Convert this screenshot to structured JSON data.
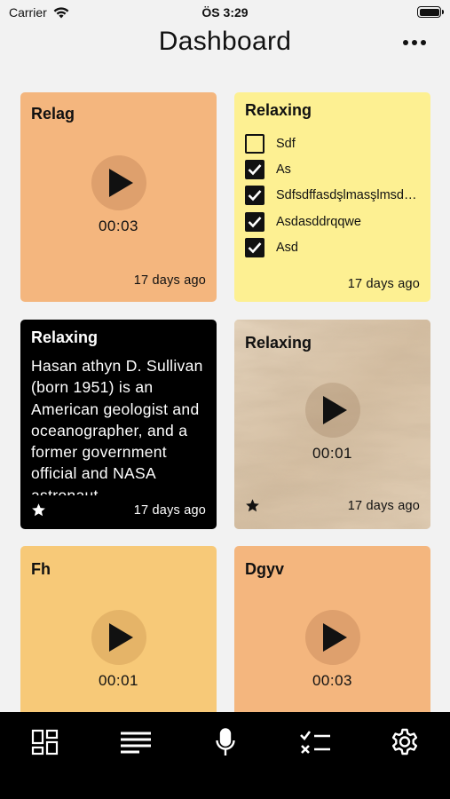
{
  "status": {
    "carrier": "Carrier",
    "time": "ÖS 3:29"
  },
  "header": {
    "title": "Dashboard",
    "more_icon": "more-horizontal-icon"
  },
  "cards": [
    {
      "kind": "audio",
      "title": "Relag",
      "duration": "00:03",
      "time": "17 days ago",
      "bg": "#f4b67e"
    },
    {
      "kind": "checklist",
      "title": "Relaxing",
      "time": "17 days ago",
      "bg": "#fdf092",
      "items": [
        {
          "label": "Sdf",
          "checked": false
        },
        {
          "label": "As",
          "checked": true
        },
        {
          "label": "Sdfsdffasdşlmasşlmsdad",
          "checked": true
        },
        {
          "label": "Asdasddrqqwe",
          "checked": true
        },
        {
          "label": "Asd",
          "checked": true
        }
      ]
    },
    {
      "kind": "text",
      "title": "Relaxing",
      "body": "Hasan athyn D. Sullivan (born 1951) is an American geologist and oceanographer, and a former government official and NASA astronaut.",
      "time": "17 days ago",
      "bg": "#000000",
      "starred": true
    },
    {
      "kind": "audio",
      "title": "Relaxing",
      "duration": "00:01",
      "time": "17 days ago",
      "bg": "marble",
      "starred": true
    },
    {
      "kind": "audio",
      "title": "Fh",
      "duration": "00:01",
      "bg": "#f7c978"
    },
    {
      "kind": "audio",
      "title": "Dgyv",
      "duration": "00:03",
      "bg": "#f4b67e"
    }
  ],
  "tabs": [
    {
      "name": "dashboard-grid-icon"
    },
    {
      "name": "notes-list-icon"
    },
    {
      "name": "microphone-icon"
    },
    {
      "name": "checklist-icon"
    },
    {
      "name": "settings-gear-icon"
    }
  ],
  "colors": {
    "tab_bar": "#000000",
    "accent_orange": "#f4b67e",
    "accent_yellow": "#fdf092",
    "accent_gold": "#f7c978"
  }
}
